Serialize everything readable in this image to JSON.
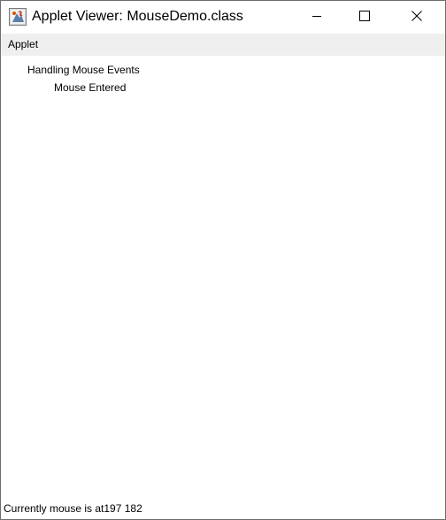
{
  "window": {
    "title": "Applet Viewer: MouseDemo.class",
    "icon": "java-applet-icon",
    "controls": {
      "minimize": "minimize-icon",
      "maximize": "maximize-icon",
      "close": "close-icon"
    }
  },
  "menubar": {
    "items": [
      {
        "label": "Applet"
      }
    ]
  },
  "applet": {
    "heading": "Handling Mouse Events",
    "event_message": "Mouse Entered",
    "status": {
      "prefix": "Currently mouse is at",
      "x": "197",
      "y": "182"
    }
  },
  "colors": {
    "menubar_bg": "#efefef",
    "window_bg": "#ffffff",
    "text": "#000000"
  }
}
